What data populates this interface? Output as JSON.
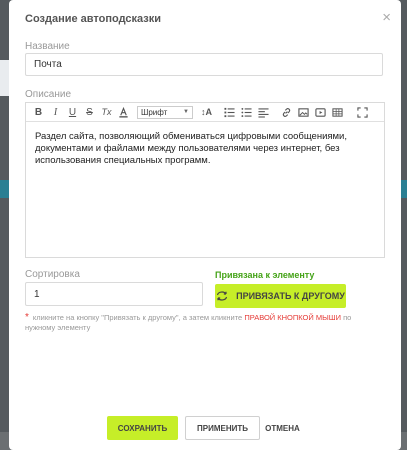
{
  "modal": {
    "title": "Создание автоподсказки",
    "close_glyph": "×"
  },
  "name_field": {
    "label": "Название",
    "value": "Почта"
  },
  "description_field": {
    "label": "Описание",
    "toolbar": {
      "bold": "B",
      "italic": "I",
      "underline": "U",
      "strike": "S",
      "clear_format": "Tx",
      "font_select": "Шрифт",
      "font_size": "↕A",
      "icons": [
        "bold-icon",
        "italic-icon",
        "underline-icon",
        "strikethrough-icon",
        "clear-format-icon",
        "text-color-icon",
        "font-size-icon",
        "ordered-list-icon",
        "unordered-list-icon",
        "align-icon",
        "link-icon",
        "image-icon",
        "video-icon",
        "table-icon",
        "fullscreen-icon"
      ]
    },
    "content": "Раздел сайта, позволяющий обмениваться цифровыми сообщениями, документами и файлами между пользователями через интернет, без использования специальных программ."
  },
  "sort_field": {
    "label": "Сортировка",
    "value": "1"
  },
  "binding": {
    "status": "Привязана к элементу",
    "button": "ПРИВЯЗАТЬ К ДРУГОМУ"
  },
  "hint": {
    "star": "*",
    "text_before": "кликните на кнопку \"Привязать к другому\", а затем кликните ",
    "highlight": "ПРАВОЙ КНОПКОЙ МЫШИ",
    "text_after": " по нужному элементу"
  },
  "footer": {
    "save": "СОХРАНИТЬ",
    "apply": "ПРИМЕНИТЬ",
    "cancel": "ОТМЕНА"
  },
  "colors": {
    "accent": "#c6ee28",
    "linked_text": "#45a318",
    "hint_highlight": "#e53935",
    "overlay": "#555a5e"
  }
}
